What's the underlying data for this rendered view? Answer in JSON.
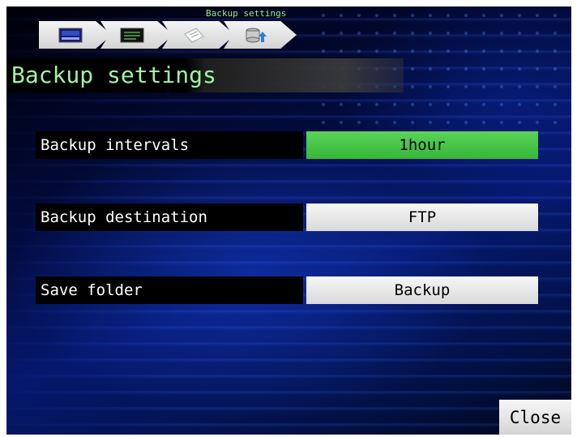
{
  "breadcrumb": {
    "caption": "Backup settings",
    "items": [
      {
        "icon": "monitor-menu-icon"
      },
      {
        "icon": "display-screen-icon"
      },
      {
        "icon": "document-icon"
      },
      {
        "icon": "backup-database-icon"
      }
    ]
  },
  "page": {
    "title": "Backup settings"
  },
  "settings": {
    "interval": {
      "label": "Backup intervals",
      "value": "1hour"
    },
    "destination": {
      "label": "Backup destination",
      "value": "FTP"
    },
    "folder": {
      "label": "Save folder",
      "value": "Backup"
    }
  },
  "footer": {
    "close_label": "Close"
  },
  "colors": {
    "title_text": "#9ff59f",
    "active_value_bg": "#48c448",
    "value_bg": "#e8e8e8"
  }
}
